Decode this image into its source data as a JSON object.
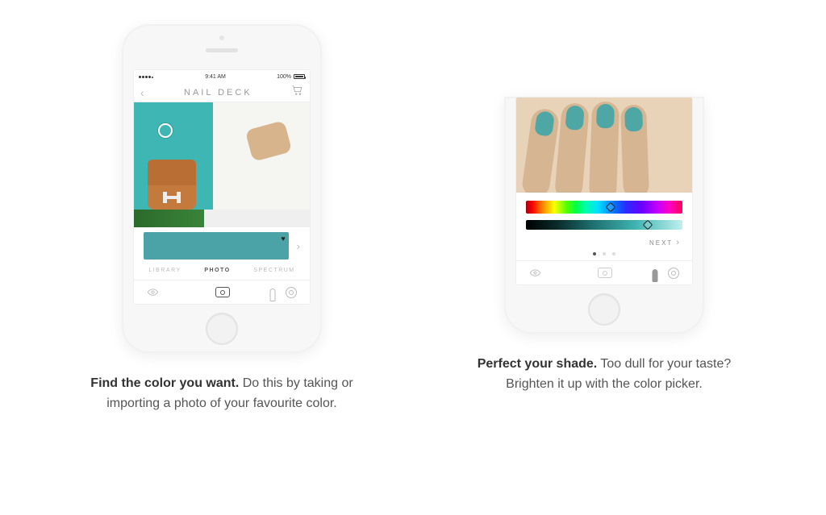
{
  "phone1": {
    "status": {
      "time": "9:41 AM",
      "battery": "100%"
    },
    "nav": {
      "title": "NAIL DECK"
    },
    "tabs": {
      "library": "LIBRARY",
      "photo": "PHOTO",
      "spectrum": "SPECTRUM"
    },
    "swatch_color": "#4ba3a8"
  },
  "phone2": {
    "next_label": "NEXT",
    "hue_position_pct": 54,
    "light_position_pct": 78
  },
  "captions": {
    "left_bold": "Find the color you want.",
    "left_rest": " Do this by taking or importing a photo of your favourite color.",
    "right_bold": "Perfect your shade.",
    "right_rest": " Too dull for your taste? Brighten it up with the color picker."
  }
}
